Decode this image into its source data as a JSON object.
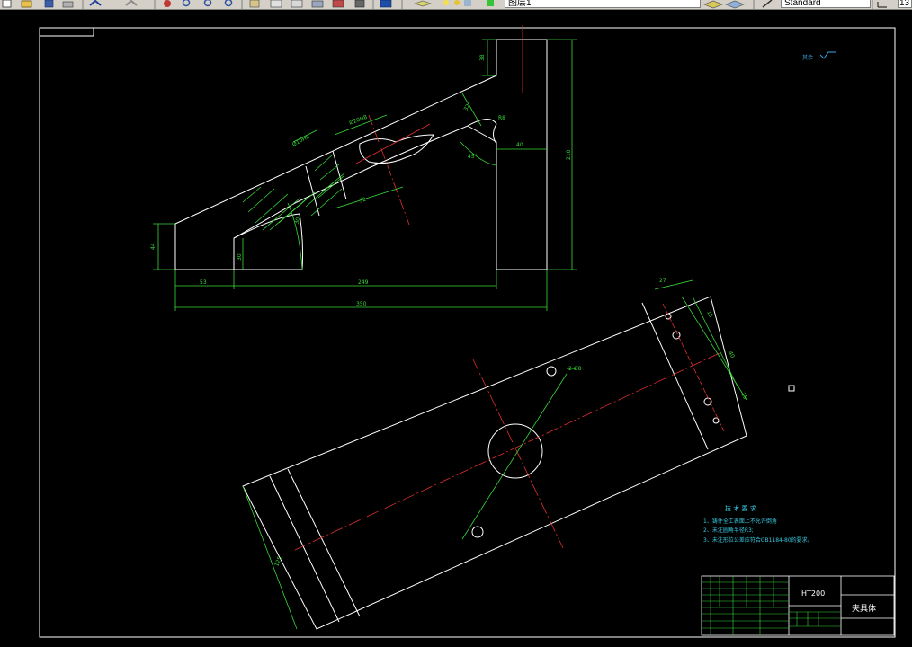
{
  "toolbar": {
    "layer_combo_value": "图层1",
    "style_combo_value": "Standard",
    "scale_combo_value": "13",
    "icons": [
      "new-icon",
      "open-icon",
      "save-icon",
      "print-icon",
      "preview-icon",
      "undo-icon",
      "redo-icon",
      "pan-icon",
      "zoom-realtime-icon",
      "zoom-window-icon",
      "zoom-previous-icon",
      "properties-icon",
      "design-center-icon",
      "tool-palette-icon",
      "markup-icon",
      "calculator-icon",
      "help-icon",
      "layer-manager-icon",
      "layer-state-icons",
      "make-current-icon",
      "layer-previous-icon",
      "text-style-icon",
      "dimension-style-icon"
    ]
  },
  "drawing": {
    "upper_part_dims": {
      "d38": "38",
      "d32_angle": "32",
      "d40": "40",
      "d210": "210",
      "d44": "44",
      "d30": "30",
      "d53": "53",
      "d249": "249",
      "d350": "350",
      "d52": "52",
      "d30_small": "30",
      "r1": "R8",
      "hole_a": "Ø10H8",
      "hole_b": "Ø20H8",
      "angle": "45°"
    },
    "lower_part_dims": {
      "d27": "27",
      "d15a": "15",
      "d40b": "40",
      "d15b": "15",
      "d12": "12",
      "hole_note": "2-Ø8",
      "width": "125"
    },
    "surface_note": "其余",
    "tech_requirements": {
      "title": "技 术 要 求",
      "items": [
        "1、铸件全工表面上不允许倒角",
        "2、未注圆角半径R3;",
        "3、未注形位公差应符合GB1184-80的要求。"
      ]
    },
    "title_block": {
      "material": "HT200",
      "part_name": "夹具体"
    }
  }
}
